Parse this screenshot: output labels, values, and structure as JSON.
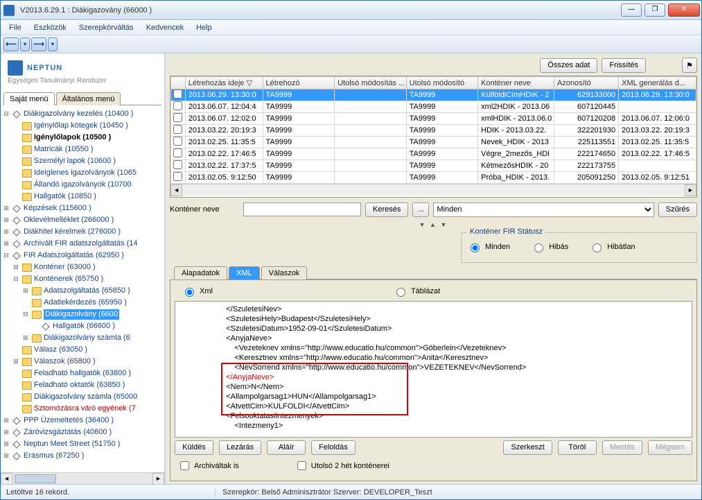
{
  "window": {
    "title": "V2013.6.29.1 : Diákigazovány (66000  )"
  },
  "menu": [
    "File",
    "Eszközök",
    "Szerepkörváltás",
    "Kedvencek",
    "Help"
  ],
  "logo": {
    "brand": "NEPTUN",
    "sub": "Egységes Tanulmányi Rendszer"
  },
  "leftTabs": {
    "t1": "Saját menü",
    "t2": "Általános menü"
  },
  "tree": {
    "n1": "Diákigazolvány kezelés (10400  )",
    "n1a": "Igénylőlap kötegek (10450  )",
    "n1b": "Igénylőlapok  (10500   )",
    "n1c": "Matricák  (10550   )",
    "n1d": "Személyi lapok (10600  )",
    "n1e": "Ideiglenes igazolványok (1065",
    "n1f": "Állandó igazolványok (10700",
    "n1g": "Hallgatók (10850  )",
    "n2": "Képzések  (115600  )",
    "n3": "Oklevélmelléklet (266000  )",
    "n4": "Diákhitel kérelmek (276000  )",
    "n5": "Archivált FIR adatszolgáltatás (14",
    "n6": "FIR Adatszolgáltatás (62950  )",
    "n6a": "Konténer (63000  )",
    "n6b": "Konténerek (65750  )",
    "n6b1": "Adatszolgáltatás (65850  )",
    "n6b2": "Adatlekérdezés (65950  )",
    "n6b3": "Diákigazolvány (6600",
    "n6b3a": "Hallgatók (66600  )",
    "n6b4": "Diákigazolvány számla (6",
    "n6c": "Válasz (63050  )",
    "n6d": "Válaszok (65800  )",
    "n6e": "Feladható hallgatók (63800  )",
    "n6f": "Feladható oktatók (63850  )",
    "n6g": "Diákigazolvány számla (65000",
    "n6h": "Sztornózásra váró egyének (7",
    "n7": "PPP Üzemeltetés (36400  )",
    "n8": "Záróvizsgáztatás (40600  )",
    "n9": "Neptun Meet Street (51750  )",
    "n10": "Erasmus (67250  )"
  },
  "topButtons": {
    "all": "Összes adat",
    "refresh": "Frissítés"
  },
  "gridHeaders": {
    "c0": "",
    "c1": "Létrehozás ideje",
    "c2": "Létrehozó",
    "c3": "Utolsó módosítás ...",
    "c4": "Utolsó módosító",
    "c5": "Konténer neve",
    "c6": "Azonosító",
    "c7": "XML generálás d..."
  },
  "rows": [
    {
      "d": "2013.06.29. 13:30:0",
      "cr": "TA9999",
      "lm": "",
      "lmu": "TA9999",
      "kn": "KülföldiCímHDIK - 2",
      "id": "629133000",
      "xml": "2013.06.29. 13:30:0"
    },
    {
      "d": "2013.06.07. 12:04:4",
      "cr": "TA9999",
      "lm": "",
      "lmu": "TA9999",
      "kn": "xml2HDIK - 2013.06",
      "id": "607120445",
      "xml": ""
    },
    {
      "d": "2013.06.07. 12:02:0",
      "cr": "TA9999",
      "lm": "",
      "lmu": "TA9999",
      "kn": "xmlHDIK - 2013.06.0",
      "id": "607120208",
      "xml": "2013.06.07. 12:06:0"
    },
    {
      "d": "2013.03.22. 20:19:3",
      "cr": "TA9999",
      "lm": "",
      "lmu": "TA9999",
      "kn": "HDIK - 2013.03.22.",
      "id": "322201930",
      "xml": "2013.03.22. 20:19:3"
    },
    {
      "d": "2013.02.25. 11:35:5",
      "cr": "TA9999",
      "lm": "",
      "lmu": "TA9999",
      "kn": "Nevek_HDIK - 2013",
      "id": "225113551",
      "xml": "2013.02.25. 11:35:5"
    },
    {
      "d": "2013.02.22. 17:46:5",
      "cr": "TA9999",
      "lm": "",
      "lmu": "TA9999",
      "kn": "Végre_2mezős_HDI",
      "id": "222174650",
      "xml": "2013.02.22. 17:46:5"
    },
    {
      "d": "2013.02.22. 17:37:5",
      "cr": "TA9999",
      "lm": "",
      "lmu": "TA9999",
      "kn": "KétmezősHDIK - 20",
      "id": "222173755",
      "xml": ""
    },
    {
      "d": "2013.02.05. 9:12:50",
      "cr": "TA9999",
      "lm": "",
      "lmu": "TA9999",
      "kn": "Próba_HDIK - 2013.",
      "id": "205091250",
      "xml": "2013.02.05. 9:12:51"
    }
  ],
  "search": {
    "label": "Konténer neve",
    "btn": "Keresés",
    "dots": "...",
    "dropdown": "Minden",
    "filter": "Szűrés"
  },
  "statusGroup": {
    "legend": "Konténer FIR Státusz",
    "r1": "Minden",
    "r2": "Hibás",
    "r3": "Hibátlan"
  },
  "innerTabs": {
    "t1": "Alapadatok",
    "t2": "XML",
    "t3": "Válaszok"
  },
  "xmlRadios": {
    "r1": "Xml",
    "r2": "Táblázat"
  },
  "xml": {
    "l1": "                      </SzuletesiNev>",
    "l2": "                      <SzuletesiHely>Budapest</SzuletesiHely>",
    "l3": "                      <SzuletesiDatum>1952-09-01</SzuletesiDatum>",
    "l4": "                      <AnyjaNeve>",
    "l5": "                          <Vezeteknev xmlns=\"http://www.educatio.hu/common\">Göberlein</Vezeteknev>",
    "l6": "                          <Keresztnev xmlns=\"http://www.educatio.hu/common\">Anita</Keresztnev>",
    "l7": "                          <NevSorrend xmlns=\"http://www.educatio.hu/common\">VEZETEKNEV</NevSorrend>",
    "l8": "                      </AnyjaNeve>",
    "l9": "                      <Nem>N</Nem>",
    "l10": "                      <Allampolgarsag1>HUN</Allampolgarsag1>",
    "l11": "                      <AtvettCim>KULFOLDI</AtvettCim>",
    "l12": "                      <FelsooktatasiIntezmenyek>",
    "l13": "                          <Intezmeny1>"
  },
  "actionButtons": {
    "send": "Küldés",
    "close": "Lezárás",
    "sign": "Aláír",
    "unlock": "Feloldás",
    "edit": "Szerkeszt",
    "del": "Töröl",
    "save": "Mentés",
    "cancel": "Mégsem"
  },
  "checks": {
    "c1": "Archiváltak is",
    "c2": "Utolsó 2 hét konténerei"
  },
  "status": {
    "left": "Letöltve 16 rekord.",
    "mid": "Szerepkör: Belső Adminisztrátor   Szerver: DEVELOPER_Teszt"
  }
}
